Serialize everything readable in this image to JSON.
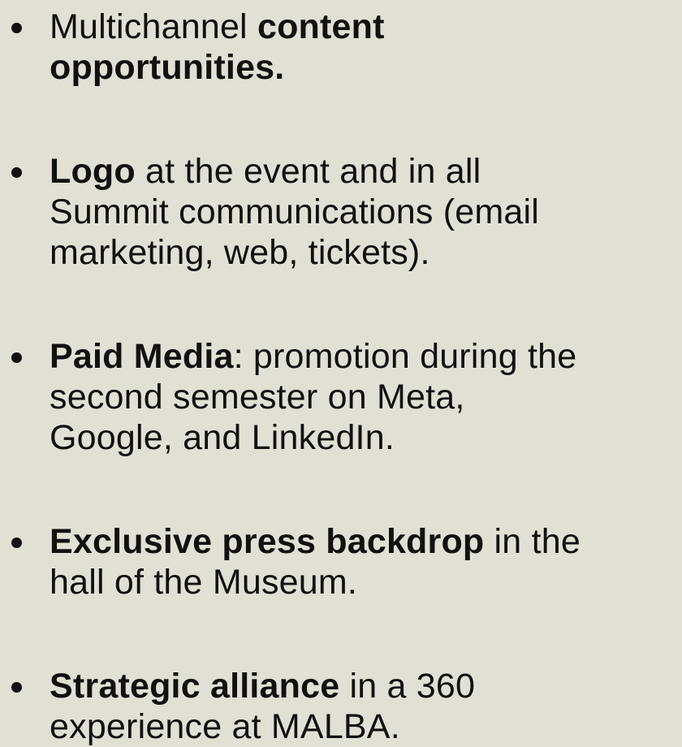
{
  "bullets": [
    {
      "lines": [
        [
          {
            "text": "Multichannel ",
            "bold": false
          },
          {
            "text": "content",
            "bold": true
          }
        ],
        [
          {
            "text": "opportunities.",
            "bold": true
          }
        ]
      ]
    },
    {
      "lines": [
        [
          {
            "text": "Logo",
            "bold": true
          },
          {
            "text": " at the event and in all",
            "bold": false
          }
        ],
        [
          {
            "text": "Summit communications (email",
            "bold": false
          }
        ],
        [
          {
            "text": "marketing, web, tickets).",
            "bold": false
          }
        ]
      ]
    },
    {
      "lines": [
        [
          {
            "text": "Paid Media",
            "bold": true
          },
          {
            "text": ": promotion during the",
            "bold": false
          }
        ],
        [
          {
            "text": "second semester on Meta,",
            "bold": false
          }
        ],
        [
          {
            "text": "Google, and LinkedIn.",
            "bold": false
          }
        ]
      ]
    },
    {
      "lines": [
        [
          {
            "text": "Exclusive press backdrop",
            "bold": true
          },
          {
            "text": " in the",
            "bold": false
          }
        ],
        [
          {
            "text": "hall of the Museum.",
            "bold": false
          }
        ]
      ]
    },
    {
      "lines": [
        [
          {
            "text": "Strategic alliance",
            "bold": true
          },
          {
            "text": " in a 360",
            "bold": false
          }
        ],
        [
          {
            "text": "experience at MALBA.",
            "bold": false
          }
        ]
      ]
    }
  ]
}
